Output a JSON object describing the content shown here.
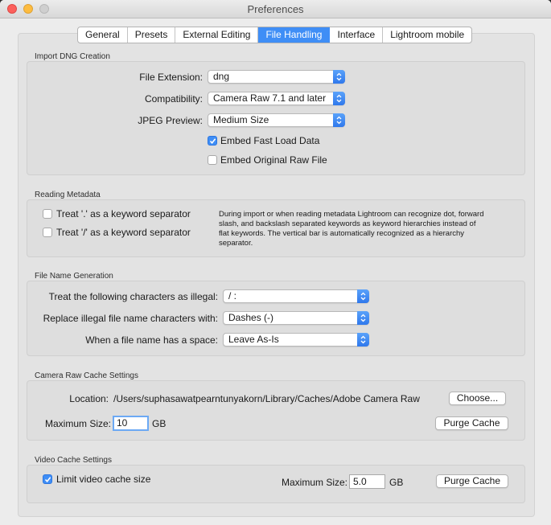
{
  "window": {
    "title": "Preferences"
  },
  "tabs": [
    {
      "label": "General",
      "active": false
    },
    {
      "label": "Presets",
      "active": false
    },
    {
      "label": "External Editing",
      "active": false
    },
    {
      "label": "File Handling",
      "active": true
    },
    {
      "label": "Interface",
      "active": false
    },
    {
      "label": "Lightroom mobile",
      "active": false
    }
  ],
  "import_dng": {
    "title": "Import DNG Creation",
    "file_extension_label": "File Extension:",
    "file_extension_value": "dng",
    "compatibility_label": "Compatibility:",
    "compatibility_value": "Camera Raw 7.1 and later",
    "jpeg_preview_label": "JPEG Preview:",
    "jpeg_preview_value": "Medium Size",
    "embed_fast_load_label": "Embed Fast Load Data",
    "embed_fast_load_checked": true,
    "embed_original_label": "Embed Original Raw File",
    "embed_original_checked": false
  },
  "reading_metadata": {
    "title": "Reading Metadata",
    "dot_label": "Treat '.' as a keyword separator",
    "dot_checked": false,
    "slash_label": "Treat '/' as a keyword separator",
    "slash_checked": false,
    "description": "During import or when reading metadata Lightroom can recognize dot, forward slash, and backslash separated keywords as keyword hierarchies instead of flat keywords. The vertical bar is automatically recognized as a hierarchy separator."
  },
  "file_name_generation": {
    "title": "File Name Generation",
    "illegal_label": "Treat the following characters as illegal:",
    "illegal_value": "/ :",
    "replace_label": "Replace illegal file name characters with:",
    "replace_value": "Dashes (-)",
    "space_label": "When a file name has a space:",
    "space_value": "Leave As-Is"
  },
  "camera_raw_cache": {
    "title": "Camera Raw Cache Settings",
    "location_label": "Location:",
    "location_value": "/Users/suphasawatpearntunyakorn/Library/Caches/Adobe Camera Raw",
    "choose_button": "Choose...",
    "max_size_label": "Maximum Size:",
    "max_size_value": "10",
    "unit": "GB",
    "purge_button": "Purge Cache"
  },
  "video_cache": {
    "title": "Video Cache Settings",
    "limit_label": "Limit video cache size",
    "limit_checked": true,
    "max_size_label": "Maximum Size:",
    "max_size_value": "5.0",
    "unit": "GB",
    "purge_button": "Purge Cache"
  },
  "colors": {
    "accent": "#3f8ef6"
  }
}
